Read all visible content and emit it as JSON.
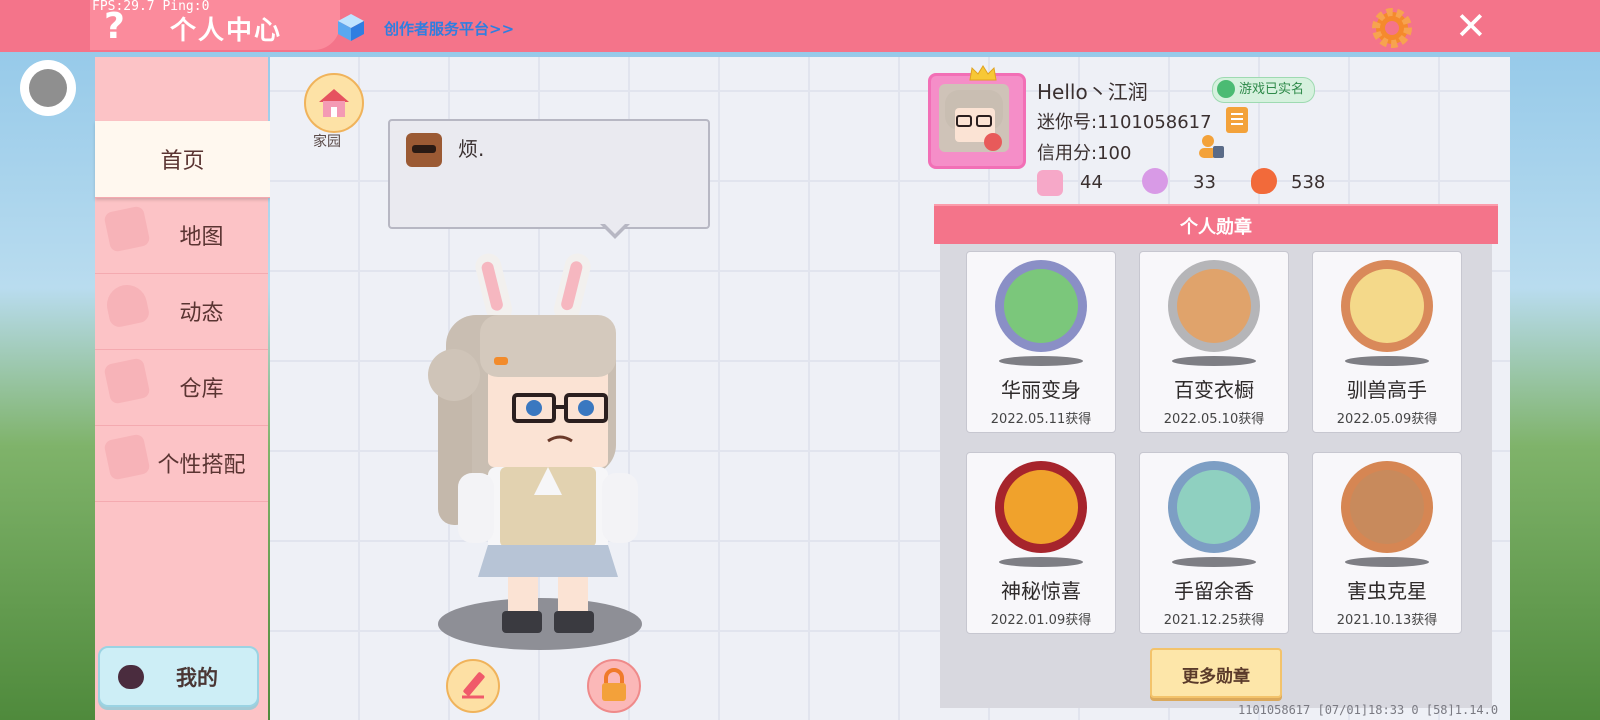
{
  "debug": {
    "fps_text": "FPS:29.7  Ping:0"
  },
  "header": {
    "help_glyph": "?",
    "title": "个人中心",
    "creator_link": "创作者服务平台>>",
    "close_glyph": "✕"
  },
  "sidebar": {
    "items": [
      {
        "label": "首页",
        "active": true
      },
      {
        "label": "地图"
      },
      {
        "label": "动态"
      },
      {
        "label": "仓库"
      },
      {
        "label": "个性搭配"
      }
    ],
    "my_label": "我的"
  },
  "home": {
    "label": "家园"
  },
  "speech": {
    "text": "烦."
  },
  "profile": {
    "username": "Hello丶江润",
    "verified": "游戏已实名",
    "uid": "迷你号:1101058617",
    "credit": "信用分:100",
    "stats": [
      {
        "icon": "plus-badge-icon",
        "value": "44"
      },
      {
        "icon": "cheer-person-icon",
        "value": "33"
      },
      {
        "icon": "flame-icon",
        "value": "538"
      }
    ]
  },
  "medals": {
    "title": "个人勋章",
    "items": [
      {
        "name": "华丽变身",
        "date": "2022.05.11获得",
        "ring": "#8a8fc6",
        "core": "#7bc77b"
      },
      {
        "name": "百变衣橱",
        "date": "2022.05.10获得",
        "ring": "#b5b5b8",
        "core": "#e0a36b"
      },
      {
        "name": "驯兽高手",
        "date": "2022.05.09获得",
        "ring": "#d9895a",
        "core": "#f4d98a"
      },
      {
        "name": "神秘惊喜",
        "date": "2022.01.09获得",
        "ring": "#a6242c",
        "core": "#f0a22c"
      },
      {
        "name": "手留余香",
        "date": "2021.12.25获得",
        "ring": "#7d9ec4",
        "core": "#8fd0c0"
      },
      {
        "name": "害虫克星",
        "date": "2021.10.13获得",
        "ring": "#d68653",
        "core": "#c88a5c"
      }
    ],
    "more_label": "更多勋章"
  },
  "footer": {
    "text": "1101058617   [07/01]18:33 0  [58]1.14.0"
  },
  "colors": {
    "accent": "#f4748a",
    "sidebar": "#fcc3c6",
    "panel": "#eef0f6"
  }
}
